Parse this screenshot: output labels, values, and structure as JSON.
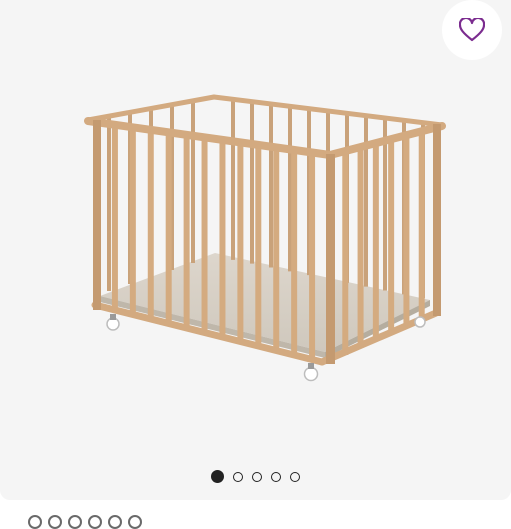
{
  "gallery": {
    "image_alt": "Wooden playpen",
    "favorite_icon": "heart-outline-icon",
    "accent_color": "#7b2c8f",
    "slides_total": 5,
    "active_slide": 1
  }
}
